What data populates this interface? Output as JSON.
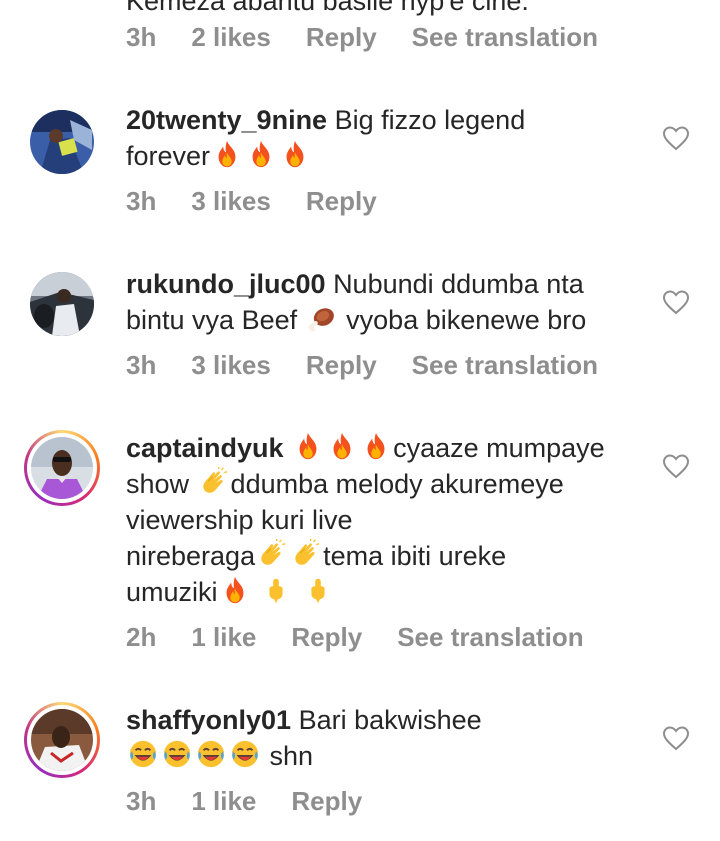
{
  "top_partial": {
    "text_fragment": "Kemeza abantu basile hyp'e cirle.",
    "time": "3h",
    "likes": "2 likes",
    "reply": "Reply",
    "translate": "See translation"
  },
  "comments": [
    {
      "username": "20twenty_9nine",
      "text_a": "Big fizzo legend",
      "text_b": "forever",
      "time": "3h",
      "likes": "3 likes",
      "reply": "Reply"
    },
    {
      "username": "rukundo_jluc00",
      "text_a": "Nubundi ddumba nta",
      "text_b": "bintu vya Beef",
      "text_c": "vyoba bikenewe bro",
      "time": "3h",
      "likes": "3 likes",
      "reply": "Reply",
      "translate": "See translation"
    },
    {
      "username": "captaindyuk",
      "text_a": "cyaaze mumpaye",
      "text_b": "show",
      "text_c": "ddumba melody akuremeye",
      "text_d": "viewership kuri live",
      "text_e": "nireberaga",
      "text_f": "tema ibiti ureke",
      "text_g": "umuziki",
      "time": "2h",
      "likes": "1 like",
      "reply": "Reply",
      "translate": "See translation"
    },
    {
      "username": "shaffyonly01",
      "text_a": "Bari bakwishee",
      "text_b": "shn",
      "time": "3h",
      "likes": "1 like",
      "reply": "Reply"
    }
  ],
  "icons": {
    "heart": "heart-outline-icon",
    "fire": "fire-emoji",
    "meat": "meat-on-bone-emoji",
    "clap": "clapping-hands-emoji",
    "point_down": "backhand-index-pointing-down-emoji",
    "laugh": "tears-of-joy-emoji"
  },
  "colors": {
    "text": "#262626",
    "meta": "#8e8e8e",
    "story_ring": "#d62976"
  }
}
